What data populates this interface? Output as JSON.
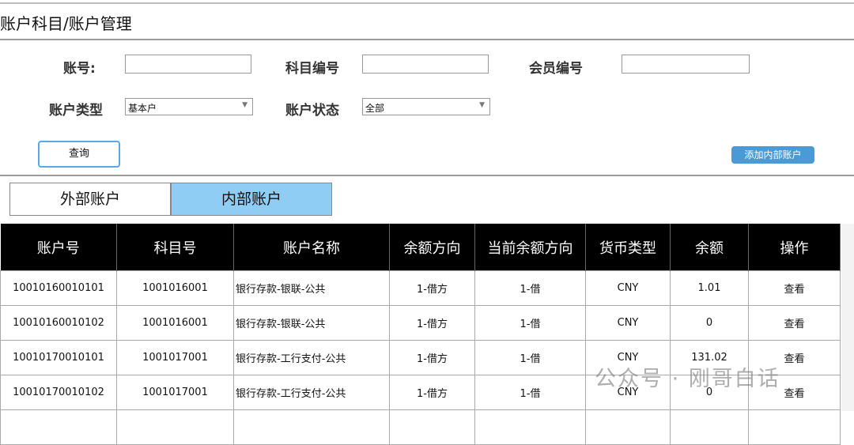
{
  "title": "账户科目/账户管理",
  "form": {
    "account_no_label": "账号:",
    "subject_no_label": "科目编号",
    "member_no_label": "会员编号",
    "account_type_label": "账户类型",
    "account_type_value": "基本户",
    "account_status_label": "账户状态",
    "account_status_value": "全部",
    "query_button": "查询",
    "add_button": "添加内部账户"
  },
  "tabs": [
    "外部账户",
    "内部账户"
  ],
  "table": {
    "headers": [
      "账户号",
      "科目号",
      "账户名称",
      "余额方向",
      "当前余额方向",
      "货币类型",
      "余额",
      "操作"
    ],
    "rows": [
      [
        "10010160010101",
        "1001016001",
        "银行存款-银联-公共",
        "1-借方",
        "1-借",
        "CNY",
        "1.01",
        "查看"
      ],
      [
        "10010160010102",
        "1001016001",
        "银行存款-银联-公共",
        "1-借方",
        "1-借",
        "CNY",
        "0",
        "查看"
      ],
      [
        "10010170010101",
        "1001017001",
        "银行存款-工行支付-公共",
        "1-借方",
        "1-借",
        "CNY",
        "131.02",
        "查看"
      ],
      [
        "10010170010102",
        "1001017001",
        "银行存款-工行支付-公共",
        "1-借方",
        "1-借",
        "CNY",
        "0",
        "查看"
      ]
    ]
  },
  "watermark": "公众号 · 刚哥白话"
}
